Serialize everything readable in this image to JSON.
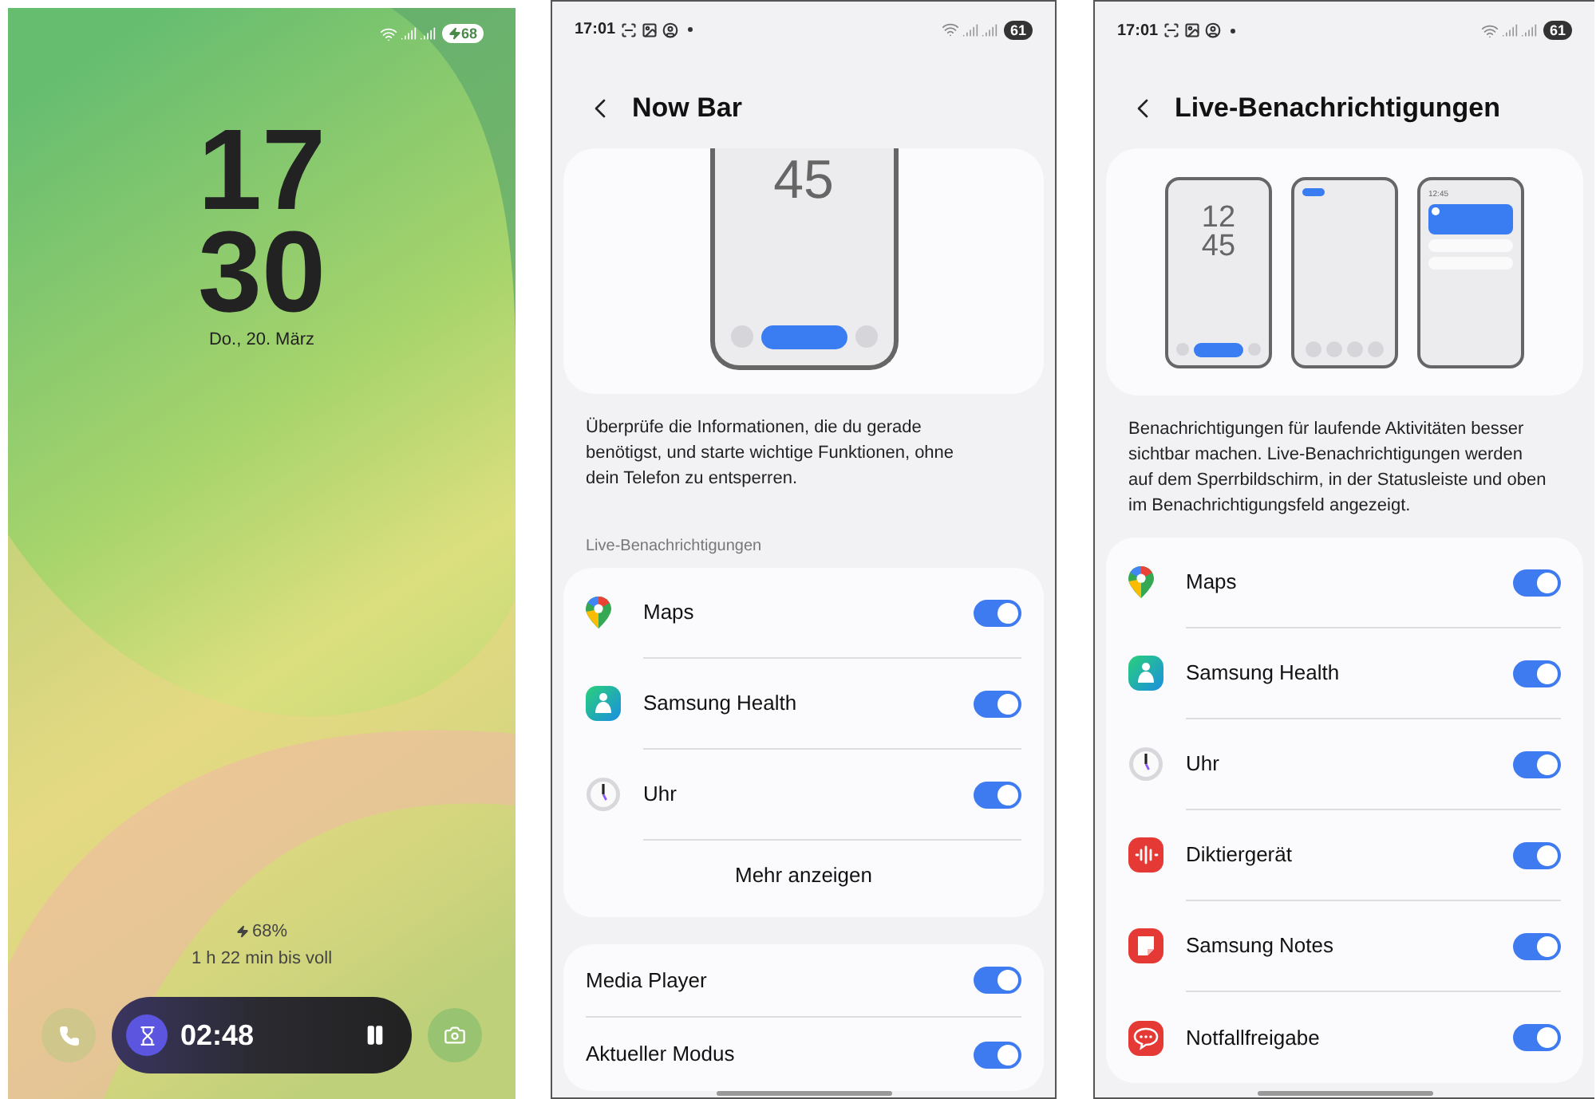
{
  "lock_screen": {
    "status_bar": {
      "battery": "68",
      "charging": true
    },
    "clock": {
      "hours": "17",
      "minutes": "30"
    },
    "date": "Do., 20. März",
    "charge": {
      "percent": "68%",
      "remaining": "1 h 22 min bis voll"
    },
    "now_bar": {
      "timer": "02:48"
    }
  },
  "now_bar_screen": {
    "status_bar": {
      "time": "17:01",
      "battery": "61"
    },
    "title": "Now Bar",
    "illustration": {
      "clock": "45"
    },
    "description": "Überprüfe die Informationen, die du gerade benötigst, und starte wichtige Funktionen, ohne dein Telefon zu entsperren.",
    "section_label": "Live-Benachrichtigungen",
    "apps": [
      {
        "name": "Maps",
        "kind": "maps",
        "on": true
      },
      {
        "name": "Samsung Health",
        "kind": "health",
        "on": true
      },
      {
        "name": "Uhr",
        "kind": "clock",
        "on": true
      }
    ],
    "more_button": "Mehr anzeigen",
    "options": [
      {
        "label": "Media Player",
        "on": true
      },
      {
        "label": "Aktueller Modus",
        "on": true
      }
    ]
  },
  "live_notifications_screen": {
    "status_bar": {
      "time": "17:01",
      "battery": "61"
    },
    "title": "Live-Benachrichtigungen",
    "illustration": {
      "clock_hours": "12",
      "clock_minutes": "45",
      "panel_time": "12:45"
    },
    "description": "Benachrichtigungen für laufende Aktivitäten besser sichtbar machen. Live-Benachrichtigungen werden auf dem Sperrbildschirm, in der Statusleiste und oben im Benachrichtigungsfeld angezeigt.",
    "apps": [
      {
        "name": "Maps",
        "kind": "maps",
        "on": true
      },
      {
        "name": "Samsung Health",
        "kind": "health",
        "on": true
      },
      {
        "name": "Uhr",
        "kind": "clock",
        "on": true
      },
      {
        "name": "Diktiergerät",
        "kind": "recorder",
        "on": true
      },
      {
        "name": "Samsung Notes",
        "kind": "notes",
        "on": true
      },
      {
        "name": "Notfallfreigabe",
        "kind": "sos",
        "on": true
      }
    ]
  }
}
